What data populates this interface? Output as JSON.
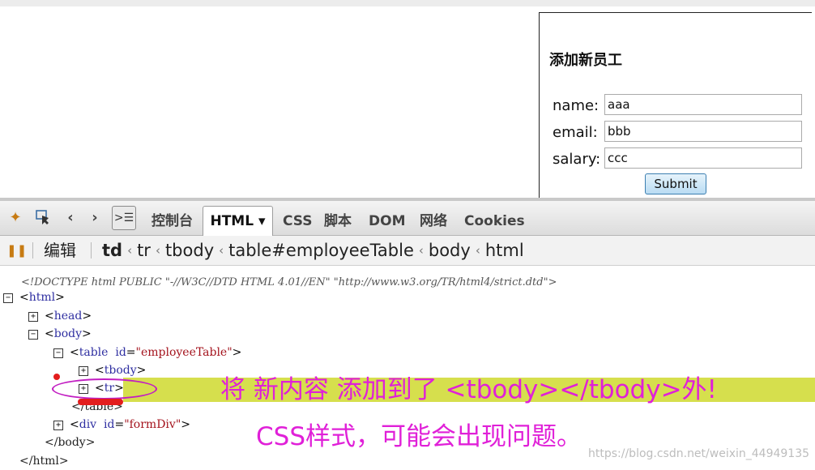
{
  "page": {
    "form_title": "添加新员工",
    "fields": [
      {
        "label": "name:",
        "value": "aaa"
      },
      {
        "label": "email:",
        "value": "bbb"
      },
      {
        "label": "salary:",
        "value": "ccc"
      }
    ],
    "submit_label": "Submit"
  },
  "devtools": {
    "tabs": [
      "控制台",
      "HTML ▾",
      "CSS",
      "脚本",
      "DOM",
      "网络",
      "Cookies"
    ],
    "active_tab": "HTML",
    "edit_label": "编辑",
    "breadcrumb": [
      "td",
      "tr",
      "tbody",
      "table#employeeTable",
      "body",
      "html"
    ],
    "breadcrumb_selected": "td",
    "tree": {
      "doctype": "<!DOCTYPE html PUBLIC \"-//W3C//DTD HTML 4.01//EN\" \"http://www.w3.org/TR/html4/strict.dtd\">",
      "html_open": "html",
      "head": "head",
      "body_open": "body",
      "table_tag": "table",
      "table_attr_name": "id",
      "table_attr_value": "\"employeeTable\"",
      "tbody": "tbody",
      "tr": "tr",
      "table_close": "</table>",
      "div_tag": "div",
      "div_attr_name": "id",
      "div_attr_value": "\"formDiv\"",
      "body_close": "</body>",
      "html_close": "</html>"
    }
  },
  "annotations": {
    "line1": "将 新内容 添加到了 <tbody></tbody>外!",
    "line2": "CSS样式，可能会出现问题。",
    "highlight_color": "#d6df4d",
    "text_color": "#e020d8"
  },
  "watermark": "https://blog.csdn.net/weixin_44949135"
}
